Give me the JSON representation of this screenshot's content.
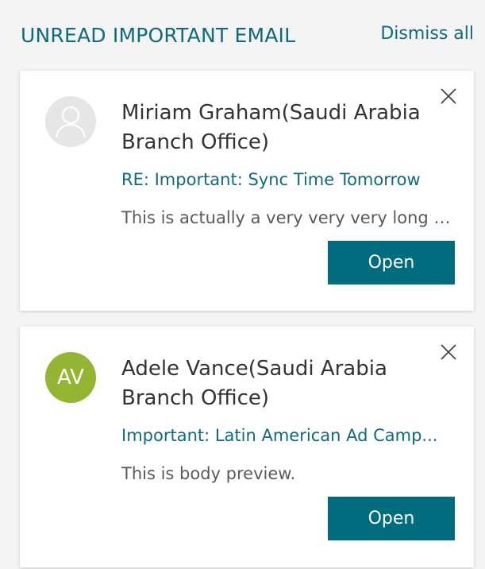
{
  "header": {
    "title": "UNREAD IMPORTANT EMAIL",
    "dismiss_all_label": "Dismiss all"
  },
  "emails": [
    {
      "sender": "Miriam Graham(Saudi Arabia Branch Office)",
      "avatar_initials": "",
      "avatar_icon": "person-placeholder-icon",
      "subject": "RE: Important: Sync Time Tomorrow",
      "preview": "This is actually a very very very long bo...",
      "open_label": "Open",
      "close_icon": "close-icon"
    },
    {
      "sender": "Adele Vance(Saudi Arabia Branch Office)",
      "avatar_initials": "AV",
      "avatar_color": "#94b534",
      "subject": "Important: Latin American Ad Camp...",
      "preview": "This is body preview.",
      "open_label": "Open",
      "close_icon": "close-icon"
    }
  ],
  "colors": {
    "accent": "#0f6a7c",
    "button": "#006c7e",
    "background": "#f4f4f4"
  }
}
